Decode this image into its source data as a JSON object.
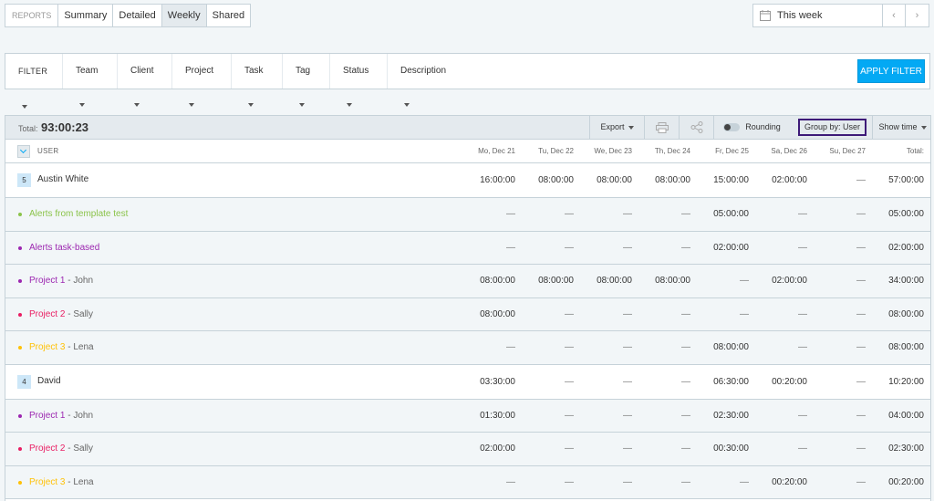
{
  "tabs": {
    "reports": "REPORTS",
    "summary": "Summary",
    "detailed": "Detailed",
    "weekly": "Weekly",
    "shared": "Shared"
  },
  "daterange": {
    "label": "This week",
    "prev": "‹",
    "next": "›"
  },
  "filters": {
    "label": "FILTER",
    "items": [
      "Team",
      "Client",
      "Project",
      "Task",
      "Tag",
      "Status",
      "Description"
    ],
    "apply": "APPLY FILTER"
  },
  "summary": {
    "total_label": "Total:",
    "total_value": "93:00:23",
    "export": "Export",
    "rounding": "Rounding",
    "group_by": "Group by: User",
    "show_time": "Show time"
  },
  "table": {
    "user_header": "USER",
    "days": [
      "Mo, Dec 21",
      "Tu, Dec 22",
      "We, Dec 23",
      "Th, Dec 24",
      "Fr, Dec 25",
      "Sa, Dec 26",
      "Su, Dec 27"
    ],
    "total_header": "Total:",
    "rows": [
      {
        "kind": "user",
        "count": "5",
        "name": "Austin White",
        "values": [
          "16:00:00",
          "08:00:00",
          "08:00:00",
          "08:00:00",
          "15:00:00",
          "02:00:00",
          "—"
        ],
        "total": "57:00:00"
      },
      {
        "kind": "proj",
        "color": "#8bc34a",
        "name": "Alerts from template test",
        "client": "",
        "values": [
          "—",
          "—",
          "—",
          "—",
          "05:00:00",
          "—",
          "—"
        ],
        "total": "05:00:00"
      },
      {
        "kind": "proj",
        "color": "#9c27b0",
        "name": "Alerts task-based",
        "client": "",
        "values": [
          "—",
          "—",
          "—",
          "—",
          "02:00:00",
          "—",
          "—"
        ],
        "total": "02:00:00"
      },
      {
        "kind": "proj",
        "color": "#9c27b0",
        "name": "Project 1",
        "client": " - John",
        "values": [
          "08:00:00",
          "08:00:00",
          "08:00:00",
          "08:00:00",
          "—",
          "02:00:00",
          "—"
        ],
        "total": "34:00:00"
      },
      {
        "kind": "proj",
        "color": "#e91e63",
        "name": "Project 2",
        "client": " - Sally",
        "values": [
          "08:00:00",
          "—",
          "—",
          "—",
          "—",
          "—",
          "—"
        ],
        "total": "08:00:00"
      },
      {
        "kind": "proj",
        "color": "#ffc107",
        "name": "Project 3",
        "client": " - Lena",
        "values": [
          "—",
          "—",
          "—",
          "—",
          "08:00:00",
          "—",
          "—"
        ],
        "total": "08:00:00"
      },
      {
        "kind": "user",
        "count": "4",
        "name": "David",
        "values": [
          "03:30:00",
          "—",
          "—",
          "—",
          "06:30:00",
          "00:20:00",
          "—"
        ],
        "total": "10:20:00"
      },
      {
        "kind": "proj",
        "color": "#9c27b0",
        "name": "Project 1",
        "client": " - John",
        "values": [
          "01:30:00",
          "—",
          "—",
          "—",
          "02:30:00",
          "—",
          "—"
        ],
        "total": "04:00:00"
      },
      {
        "kind": "proj",
        "color": "#e91e63",
        "name": "Project 2",
        "client": " - Sally",
        "values": [
          "02:00:00",
          "—",
          "—",
          "—",
          "00:30:00",
          "—",
          "—"
        ],
        "total": "02:30:00"
      },
      {
        "kind": "proj",
        "color": "#ffc107",
        "name": "Project 3",
        "client": " - Lena",
        "values": [
          "—",
          "—",
          "—",
          "—",
          "—",
          "00:20:00",
          "—"
        ],
        "total": "00:20:00"
      }
    ]
  }
}
